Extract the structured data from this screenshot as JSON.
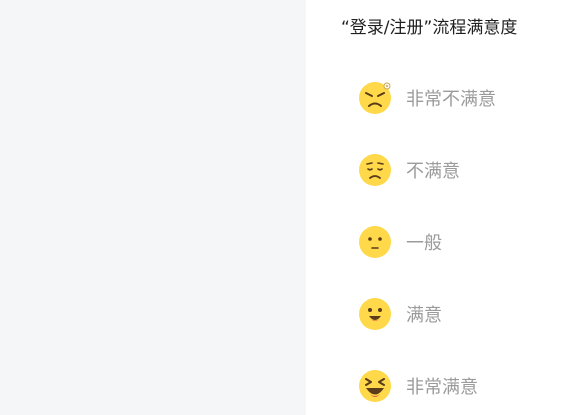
{
  "survey": {
    "title": "“登录/注册”流程满意度",
    "options": [
      {
        "label": "非常不满意",
        "icon": "very-dissatisfied-face-icon"
      },
      {
        "label": "不满意",
        "icon": "dissatisfied-face-icon"
      },
      {
        "label": "一般",
        "icon": "neutral-face-icon"
      },
      {
        "label": "满意",
        "icon": "satisfied-face-icon"
      },
      {
        "label": "非常满意",
        "icon": "very-satisfied-face-icon"
      }
    ]
  },
  "colors": {
    "emoji_face": "#ffd94a",
    "emoji_features": "#5a3b1a",
    "label_text": "#9b9b9b",
    "left_panel_bg": "#f5f6f8"
  }
}
